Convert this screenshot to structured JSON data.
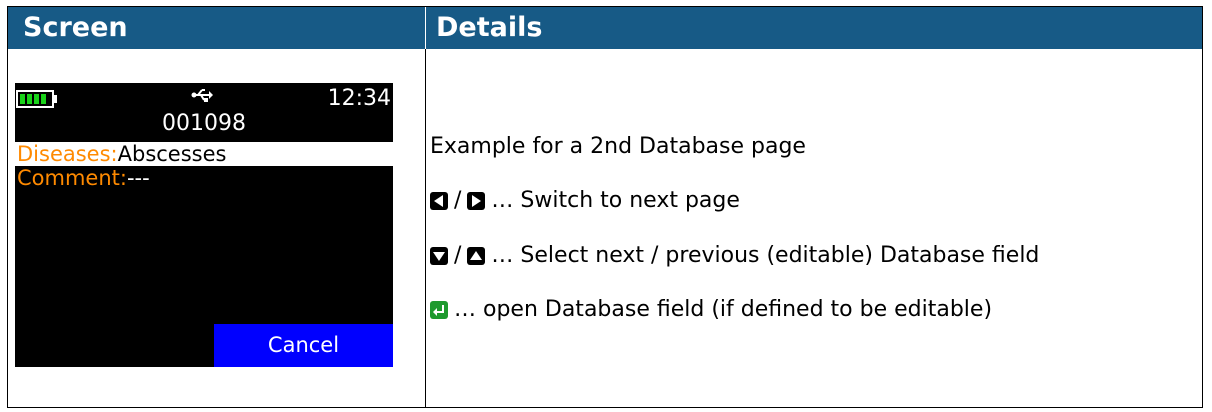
{
  "header": {
    "screen": "Screen",
    "details": "Details"
  },
  "device": {
    "battery_level": 1.0,
    "usb_icon": "usb-icon",
    "time": "12:34",
    "record_id": "001098",
    "fields": [
      {
        "label": "Diseases:",
        "value": "Abscesses",
        "selected": true
      },
      {
        "label": "Comment:",
        "value": "---",
        "selected": false
      }
    ],
    "cancel_label": "Cancel",
    "colors": {
      "background": "#000000",
      "label": "#ff8a00",
      "battery": "#19d219",
      "cancel_button": "#0000ff"
    }
  },
  "details": {
    "intro": "Example for a 2nd Database page",
    "lines": [
      {
        "icons": [
          "left-arrow-key-icon",
          "right-arrow-key-icon"
        ],
        "text": "… Switch to next page"
      },
      {
        "icons": [
          "down-arrow-key-icon",
          "up-arrow-key-icon"
        ],
        "text": "… Select next / previous (editable) Database field"
      },
      {
        "icons": [
          "enter-key-icon"
        ],
        "text": "… open Database field (if defined to be editable)"
      }
    ],
    "separator": "/"
  },
  "colors": {
    "header_background": "#175a86",
    "enter_key": "#1e9a2e"
  }
}
